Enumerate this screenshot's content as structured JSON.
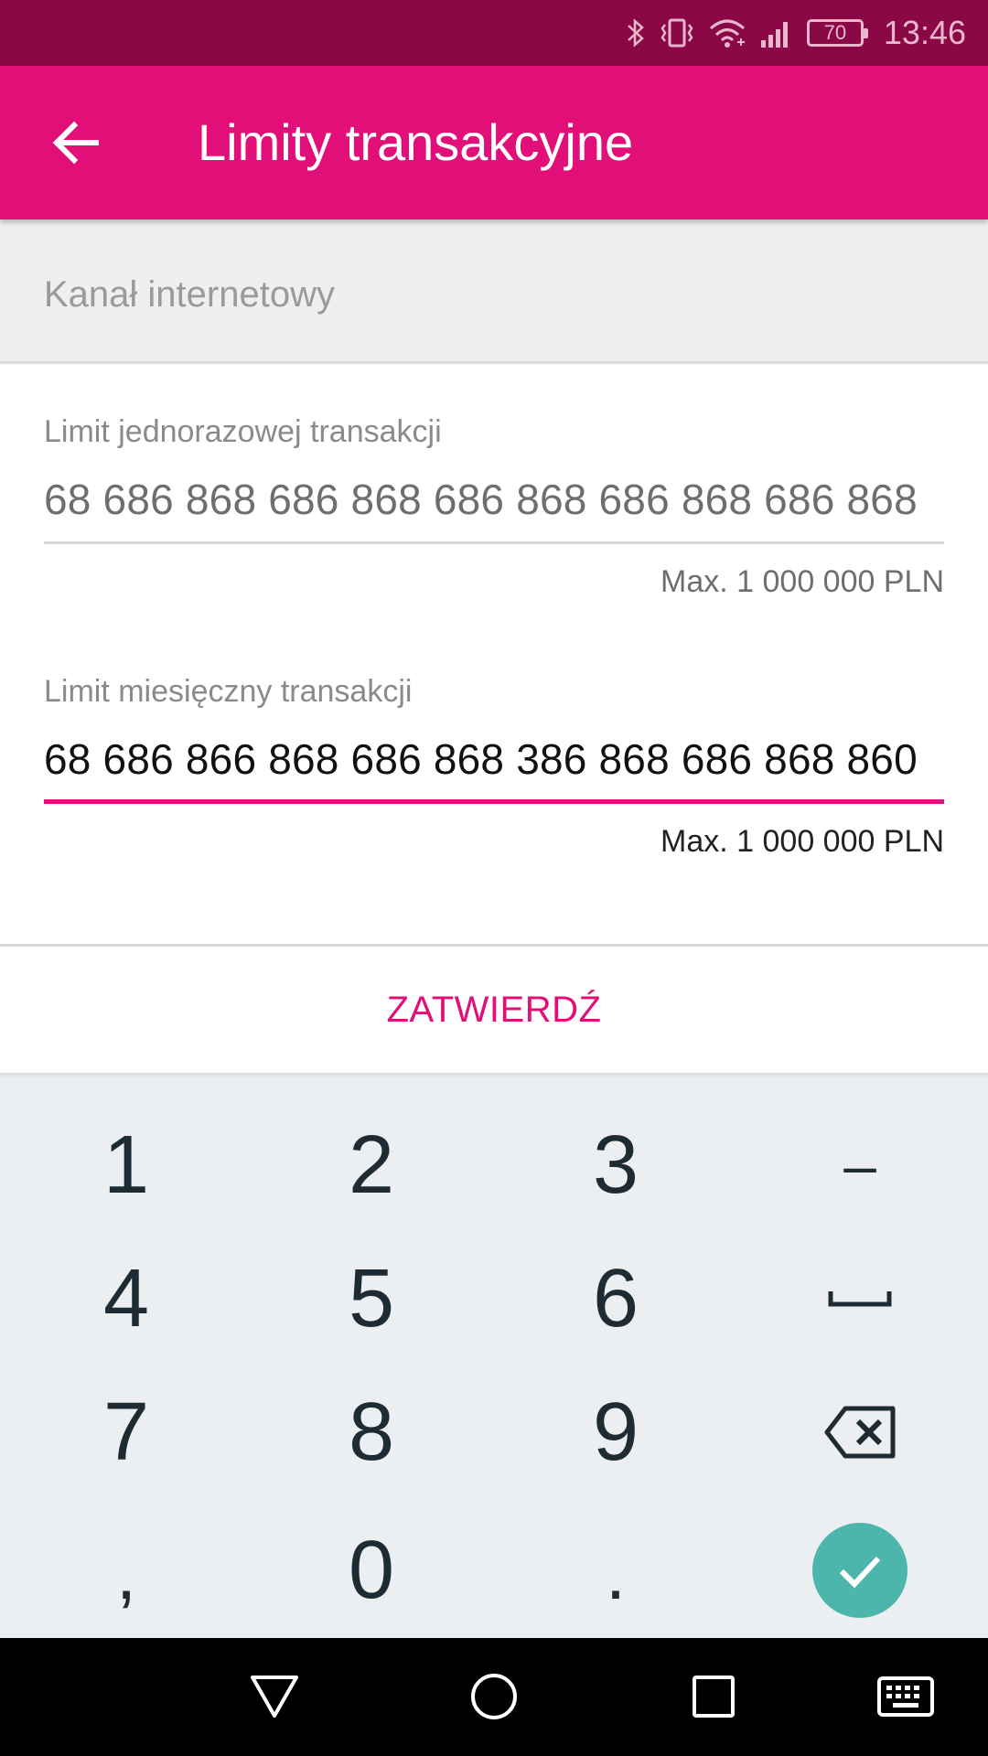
{
  "status_bar": {
    "time": "13:46",
    "battery_level": "70",
    "icons": [
      "bluetooth-icon",
      "vibrate-icon",
      "wifi-icon",
      "signal-icon",
      "battery-icon"
    ]
  },
  "app_bar": {
    "title": "Limity transakcyjne",
    "back_icon": "arrow-back-icon"
  },
  "section": {
    "title": "Kanał internetowy"
  },
  "fields": {
    "single": {
      "label": "Limit jednorazowej transakcji",
      "value": "68 686 868 686 868 686 868 686 868 686 868",
      "hint": "Max. 1 000 000 PLN"
    },
    "monthly": {
      "label": "Limit miesięczny transakcji",
      "value": "68 686 866 868 686 868 386 868 686 868 860",
      "hint": "Max. 1 000 000 PLN"
    }
  },
  "confirm_label": "ZATWIERDŹ",
  "keyboard": {
    "rows": [
      [
        "1",
        "2",
        "3",
        "–"
      ],
      [
        "4",
        "5",
        "6",
        "space"
      ],
      [
        "7",
        "8",
        "9",
        "backspace"
      ],
      [
        ",",
        "0",
        ".",
        "enter"
      ]
    ]
  },
  "nav_bar": {
    "buttons": [
      "back-triangle-icon",
      "home-circle-icon",
      "recents-square-icon",
      "keyboard-icon"
    ]
  },
  "colors": {
    "status_bar": "#8a0846",
    "accent": "#e20f79",
    "keyboard_bg": "#eceff1",
    "enter_key": "#4db6ac"
  }
}
